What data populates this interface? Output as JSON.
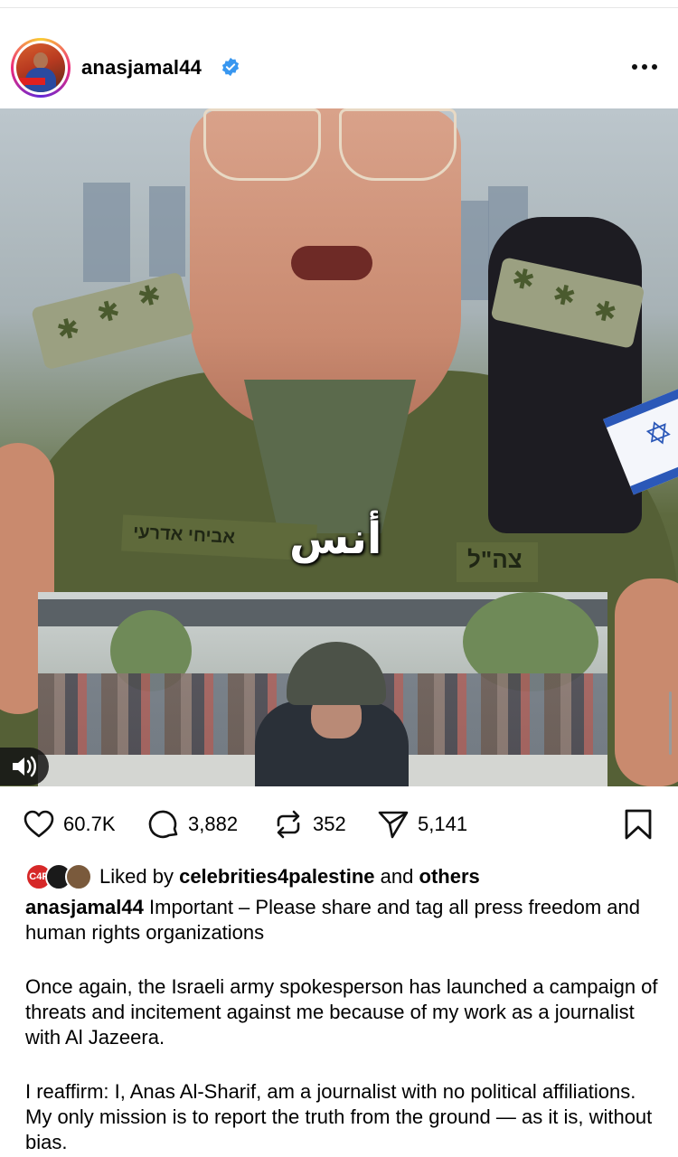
{
  "post": {
    "username": "anasjamal44",
    "verified_icon": "verified-badge-icon",
    "more_icon": "more-options-icon"
  },
  "media": {
    "overlay_caption": "أنس",
    "name_tag_text": "אביחי אדרעי",
    "unit_tag_text": "צה\"ל",
    "avatar_badge_text": "C4P"
  },
  "actions": {
    "likes": "60.7K",
    "comments": "3,882",
    "reposts": "352",
    "shares": "5,141"
  },
  "liked_by": {
    "prefix": "Liked by",
    "account": "celebrities4palestine",
    "and": "and",
    "others": "others"
  },
  "caption": {
    "username": "anasjamal44",
    "text": "Important – Please share and tag all press freedom and human rights organizations",
    "paragraph_1": "Once again, the Israeli army spokesperson has launched a campaign of threats and incitement against me because of my work as a journalist with Al Jazeera.",
    "paragraph_2": "I reaffirm: I, Anas Al-Sharif, am a journalist with no political affiliations. My only mission is to report the truth from the ground — as it is, without bias."
  },
  "colors": {
    "verified": "#3897f0",
    "text": "#000000",
    "icon": "#111111"
  }
}
